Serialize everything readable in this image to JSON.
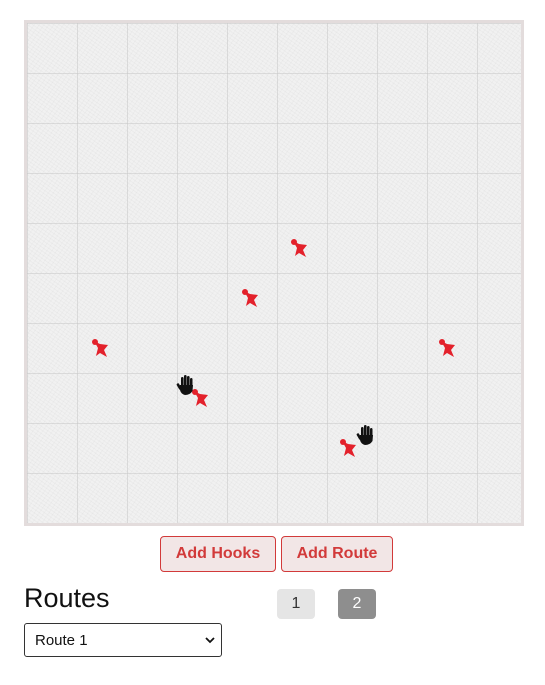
{
  "board": {
    "holds": [
      {
        "name": "hold-1",
        "color": "#e3212b"
      },
      {
        "name": "hold-2",
        "color": "#e3212b"
      },
      {
        "name": "hold-3",
        "color": "#e3212b"
      },
      {
        "name": "hold-4",
        "color": "#e3212b"
      },
      {
        "name": "hold-5",
        "color": "#e3212b"
      },
      {
        "name": "hold-6",
        "color": "#e3212b"
      }
    ],
    "hand_icons": [
      "hand-icon",
      "hand-icon"
    ]
  },
  "buttons": {
    "add_hooks": "Add Hooks",
    "add_route": "Add Route"
  },
  "routes": {
    "title": "Routes",
    "selected": "Route 1",
    "options": [
      "Route 1"
    ],
    "pages": [
      "1",
      "2"
    ],
    "active_page": "2"
  },
  "colors": {
    "accent": "#d23a3a",
    "hold": "#e3212b",
    "button_bg": "#f2e6e6",
    "page_active_bg": "#8e8e8e",
    "page_inactive_bg": "#e5e5e5"
  }
}
